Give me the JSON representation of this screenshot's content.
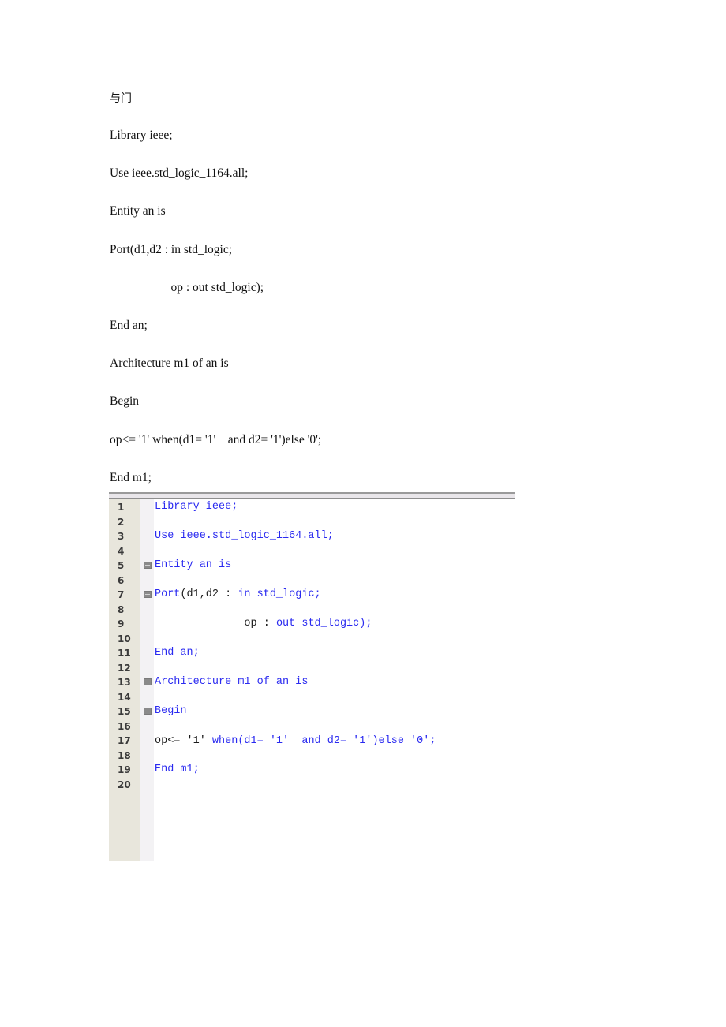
{
  "document": {
    "title": "与门",
    "lines": [
      "Library ieee;",
      "Use ieee.std_logic_1164.all;",
      "Entity an is",
      "Port(d1,d2 : in std_logic;",
      "                    op : out std_logic);",
      "End an;",
      "Architecture m1 of an is",
      "Begin",
      "op<= '1' when(d1= '1'    and d2= '1')else '0';",
      "End m1;"
    ]
  },
  "editor": {
    "colors": {
      "keyword": "#2a2af0",
      "text": "#1a1a1a",
      "gutter": "#e8e6dc",
      "fold_margin": "#f3f2f4"
    },
    "line_numbers": [
      "1",
      "2",
      "3",
      "4",
      "5",
      "6",
      "7",
      "8",
      "9",
      "10",
      "11",
      "12",
      "13",
      "14",
      "15",
      "16",
      "17",
      "18",
      "19",
      "20"
    ],
    "fold_marker_icon": "collapse-minus-box",
    "fold_lines": [
      5,
      7,
      13,
      15
    ],
    "code": {
      "l1": [
        "Library ieee;"
      ],
      "l3": [
        "Use ieee.std_logic_1164.all;"
      ],
      "l5": [
        "Entity an is"
      ],
      "l7": [
        "Port",
        "(d1,d2 : ",
        "in std_logic;"
      ],
      "l9": [
        "              op : ",
        "out std_logic);"
      ],
      "l11": [
        "End an;"
      ],
      "l13": [
        "Architecture m1 of an is"
      ],
      "l15": [
        "Begin"
      ],
      "l17": [
        "op<= '1",
        "' ",
        "when(d1= '1'  and d2= '1')else '0';"
      ],
      "l19": [
        "End m1;"
      ]
    }
  }
}
